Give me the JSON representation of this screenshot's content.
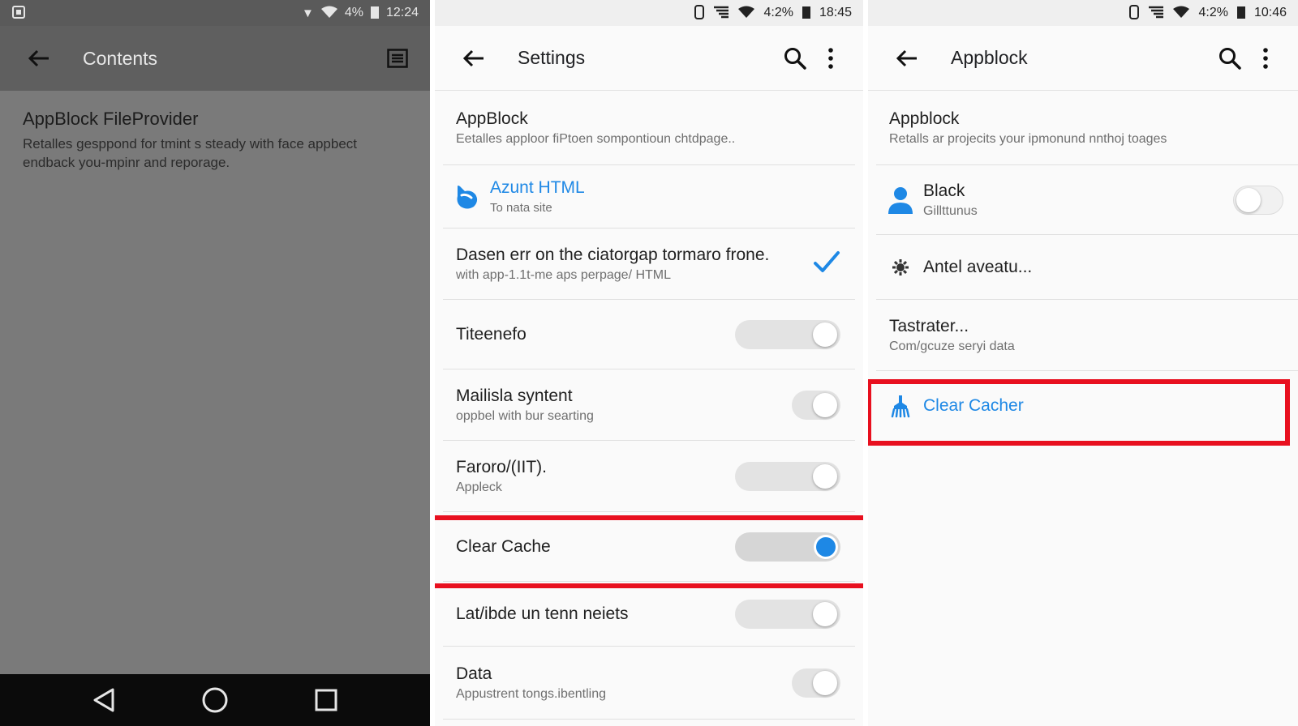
{
  "panel1": {
    "status": {
      "time": "12:24",
      "battery_text": "4%"
    },
    "appbar": {
      "title": "Contents"
    },
    "content": {
      "title": "AppBlock FileProvider",
      "description": "Retalles gesppond for tmint s steady with face appbect endback you-mpinr and reporage."
    },
    "navbar": {
      "back": "back",
      "home": "home",
      "recents": "recents"
    }
  },
  "panel2": {
    "status": {
      "battery_text": "4:2%",
      "time": "18:45"
    },
    "appbar": {
      "title": "Settings"
    },
    "rows": [
      {
        "title": "AppBlock",
        "subtitle": "Eetalles apploor fiPtoen sompontioun chtdpage.."
      },
      {
        "title": "Azunt HTML",
        "subtitle": "To nata site",
        "icon": "appblock-logo-icon"
      },
      {
        "title": "Dasen err on the ciatorgap tormaro frone.",
        "subtitle": "with app-1.1t-me aps perpage/ HTML",
        "checked": true
      },
      {
        "title": "Titeenefo",
        "switch": false
      },
      {
        "title": "Mailisla syntent",
        "subtitle": "oppbel with bur searting",
        "switch": false
      },
      {
        "title": "Faroro/(IIT).",
        "subtitle": "Appleck",
        "switch": false
      },
      {
        "title": "Clear Cache",
        "switch": true
      },
      {
        "title": "Lat/ibde un tenn neiets",
        "switch": false
      },
      {
        "title": "Data",
        "subtitle": "Appustrent tongs.ibentling",
        "switch": false
      }
    ],
    "highlight_color": "#e8101f",
    "accent_color": "#1e88e5"
  },
  "panel3": {
    "status": {
      "battery_text": "4:2%",
      "time": "10:46"
    },
    "appbar": {
      "title": "Appblock"
    },
    "rows": [
      {
        "title": "Appblock",
        "subtitle": "Retalls ar projecits your ipmonund nnthoj toages"
      },
      {
        "title": "Black",
        "subtitle": "Gillttunus",
        "icon": "person-icon",
        "switch": false
      },
      {
        "title": "Antel aveatu...",
        "icon": "gear-icon"
      },
      {
        "title": "Tastrater...",
        "subtitle": "Com/gcuze seryi data"
      },
      {
        "title": "Clear Cacher",
        "icon": "broom-icon"
      }
    ]
  }
}
